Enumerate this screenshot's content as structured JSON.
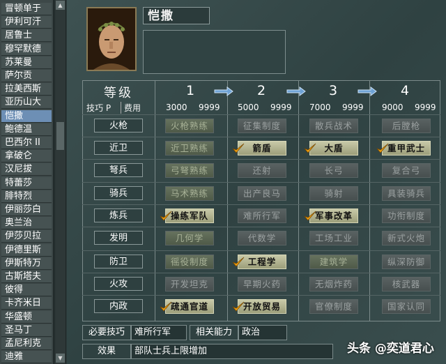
{
  "leaders": [
    "冒顿单于",
    "伊利可汗",
    "居鲁士",
    "穆罕默德",
    "苏莱曼",
    "萨尔贡",
    "拉美西斯",
    "亚历山大",
    "恺撒",
    "鲍德温",
    "巴西尔 II",
    "拿破仑",
    "汉尼拔",
    "特蕾莎",
    "腓特烈",
    "伊丽莎白",
    "奥兰治",
    "伊莎贝拉",
    "伊德里斯",
    "伊斯特万",
    "古斯塔夫",
    "彼得",
    "卡齐米日",
    "华盛顿",
    "圣马丁",
    "孟尼利克",
    "迪雅"
  ],
  "selected_leader": "恺撒",
  "name": "恺撒",
  "header": {
    "grade_label": "等级",
    "skill_label": "技巧 P",
    "cost_label": "费用",
    "levels": [
      "1",
      "2",
      "3",
      "4"
    ],
    "costs": [
      [
        "3000",
        "9999"
      ],
      [
        "5000",
        "9999"
      ],
      [
        "7000",
        "9999"
      ],
      [
        "9000",
        "9999"
      ]
    ]
  },
  "rows": [
    {
      "category": "火枪",
      "techs": [
        {
          "label": "火枪熟练",
          "state": "avail"
        },
        {
          "label": "征集制度",
          "state": "gray"
        },
        {
          "label": "散兵战术",
          "state": "gray"
        },
        {
          "label": "后膛枪",
          "state": "gray"
        }
      ]
    },
    {
      "category": "近卫",
      "techs": [
        {
          "label": "近卫熟练",
          "state": "avail"
        },
        {
          "label": "箭盾",
          "state": "done"
        },
        {
          "label": "大盾",
          "state": "done"
        },
        {
          "label": "重甲武士",
          "state": "done"
        }
      ]
    },
    {
      "category": "弩兵",
      "techs": [
        {
          "label": "弓弩熟练",
          "state": "avail"
        },
        {
          "label": "还射",
          "state": "gray"
        },
        {
          "label": "长弓",
          "state": "gray"
        },
        {
          "label": "复合弓",
          "state": "gray"
        }
      ]
    },
    {
      "category": "骑兵",
      "techs": [
        {
          "label": "马术熟练",
          "state": "avail"
        },
        {
          "label": "出产良马",
          "state": "gray"
        },
        {
          "label": "骑射",
          "state": "gray"
        },
        {
          "label": "具装骑兵",
          "state": "gray"
        }
      ]
    },
    {
      "category": "炼兵",
      "techs": [
        {
          "label": "操练军队",
          "state": "done"
        },
        {
          "label": "难所行军",
          "state": "gray"
        },
        {
          "label": "军事改革",
          "state": "done"
        },
        {
          "label": "功衔制度",
          "state": "gray"
        }
      ]
    },
    {
      "category": "发明",
      "techs": [
        {
          "label": "几何学",
          "state": "avail"
        },
        {
          "label": "代数学",
          "state": "gray"
        },
        {
          "label": "工场工业",
          "state": "gray"
        },
        {
          "label": "新式火炮",
          "state": "gray"
        }
      ]
    },
    {
      "category": "防卫",
      "techs": [
        {
          "label": "徭役制度",
          "state": "avail"
        },
        {
          "label": "工程学",
          "state": "done"
        },
        {
          "label": "建筑学",
          "state": "avail"
        },
        {
          "label": "纵深防御",
          "state": "gray"
        }
      ]
    },
    {
      "category": "火攻",
      "techs": [
        {
          "label": "开发坦克",
          "state": "gray"
        },
        {
          "label": "早期火药",
          "state": "gray"
        },
        {
          "label": "无烟炸药",
          "state": "gray"
        },
        {
          "label": "核武器",
          "state": "gray"
        }
      ]
    },
    {
      "category": "内政",
      "techs": [
        {
          "label": "疏通官道",
          "state": "done"
        },
        {
          "label": "开放贸易",
          "state": "done"
        },
        {
          "label": "官僚制度",
          "state": "gray"
        },
        {
          "label": "国家认同",
          "state": "gray"
        }
      ]
    }
  ],
  "bottom": {
    "required_label": "必要技巧",
    "required_value": "难所行军",
    "related_label": "相关能力",
    "related_value": "政治",
    "effect_label": "效果",
    "effect_value": "部队士兵上限增加"
  },
  "watermark": "头条 @奕道君心",
  "colors": {
    "selected": "#6d8fb5",
    "done_tech": "#c8c9a8",
    "check": "#f0a010"
  }
}
